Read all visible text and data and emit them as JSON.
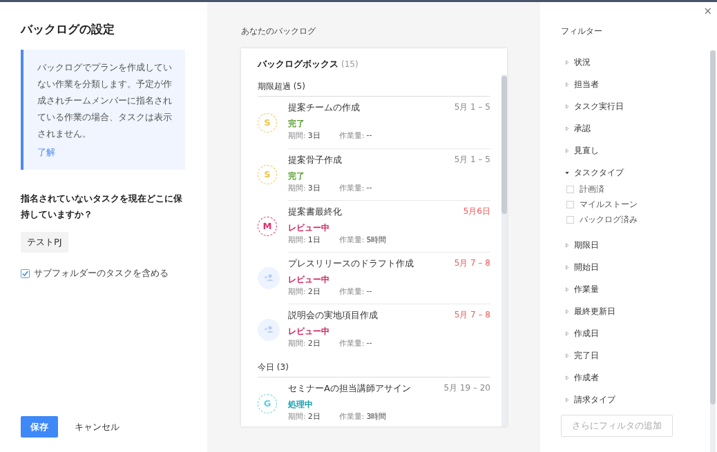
{
  "left_panel": {
    "title": "バックログの設定",
    "info": {
      "text": "バックログでプランを作成していない作業を分類します。予定が作成されチームメンバーに指名されている作業の場合、タスクは表示されません。",
      "link": "了解"
    },
    "question": "指名されていないタスクを現在どこに保持していますか？",
    "location_button": "テストPJ",
    "include_subfolders": {
      "label": "サブフォルダーのタスクを含める",
      "checked": true
    },
    "buttons": {
      "save": "保存",
      "cancel": "キャンセル"
    }
  },
  "backlog": {
    "heading": "あなたのバックログ",
    "box_title": "バックログボックス",
    "box_count": "(15)",
    "sections": [
      {
        "title": "期限超過 (5)",
        "tasks": [
          {
            "name": "提案チームの作成",
            "date": "5月 1 – 5",
            "overdue": false,
            "status": {
              "label": "完了",
              "color": "#5a9e2f"
            },
            "avatar": {
              "kind": "letter",
              "letter": "S",
              "color": "#f5c342"
            },
            "period_label": "期間:",
            "period": "3日",
            "effort_label": "作業量:",
            "effort": "--"
          },
          {
            "name": "提案骨子作成",
            "date": "5月 1 – 5",
            "overdue": false,
            "status": {
              "label": "完了",
              "color": "#5a9e2f"
            },
            "avatar": {
              "kind": "letter",
              "letter": "S",
              "color": "#f5c342"
            },
            "period_label": "期間:",
            "period": "3日",
            "effort_label": "作業量:",
            "effort": "--"
          },
          {
            "name": "提案書最終化",
            "date": "5月6日",
            "overdue": true,
            "status": {
              "label": "レビュー中",
              "color": "#d0245e"
            },
            "avatar": {
              "kind": "letter",
              "letter": "M",
              "color": "#e0306a"
            },
            "period_label": "期間:",
            "period": "1日",
            "effort_label": "作業量:",
            "effort": "5時間"
          },
          {
            "name": "プレスリリースのドラフト作成",
            "date": "5月 7 – 8",
            "overdue": true,
            "status": {
              "label": "レビュー中",
              "color": "#d0245e"
            },
            "avatar": {
              "kind": "unassigned"
            },
            "period_label": "期間:",
            "period": "2日",
            "effort_label": "作業量:",
            "effort": "--"
          },
          {
            "name": "説明会の実地項目作成",
            "date": "5月 7 – 8",
            "overdue": true,
            "status": {
              "label": "レビュー中",
              "color": "#d0245e"
            },
            "avatar": {
              "kind": "unassigned"
            },
            "period_label": "期間:",
            "period": "2日",
            "effort_label": "作業量:",
            "effort": "--"
          }
        ]
      },
      {
        "title": "今日 (3)",
        "tasks": [
          {
            "name": "セミナーAの担当講師アサイン",
            "date": "5月 19 – 20",
            "overdue": false,
            "status": {
              "label": "処理中",
              "color": "#1a9fb0"
            },
            "avatar": {
              "kind": "letter",
              "letter": "G",
              "color": "#5bd0e0"
            },
            "period_label": "期間:",
            "period": "2日",
            "effort_label": "作業量:",
            "effort": "3時間"
          }
        ]
      }
    ]
  },
  "filters": {
    "close": "×",
    "title": "フィルター",
    "items": [
      {
        "label": "状況",
        "expanded": false
      },
      {
        "label": "担当者",
        "expanded": false
      },
      {
        "label": "タスク実行日",
        "expanded": false
      },
      {
        "label": "承認",
        "expanded": false
      },
      {
        "label": "見直し",
        "expanded": false
      },
      {
        "label": "タスクタイプ",
        "expanded": true,
        "options": [
          {
            "label": "計画済",
            "checked": false
          },
          {
            "label": "マイルストーン",
            "checked": false
          },
          {
            "label": "バックログ済み",
            "checked": false
          }
        ]
      },
      {
        "label": "期限日",
        "expanded": false
      },
      {
        "label": "開始日",
        "expanded": false
      },
      {
        "label": "作業量",
        "expanded": false
      },
      {
        "label": "最終更新日",
        "expanded": false
      },
      {
        "label": "作成日",
        "expanded": false
      },
      {
        "label": "完了日",
        "expanded": false
      },
      {
        "label": "作成者",
        "expanded": false
      },
      {
        "label": "請求タイプ",
        "expanded": false
      }
    ],
    "add_button": "さらにフィルタの追加"
  }
}
